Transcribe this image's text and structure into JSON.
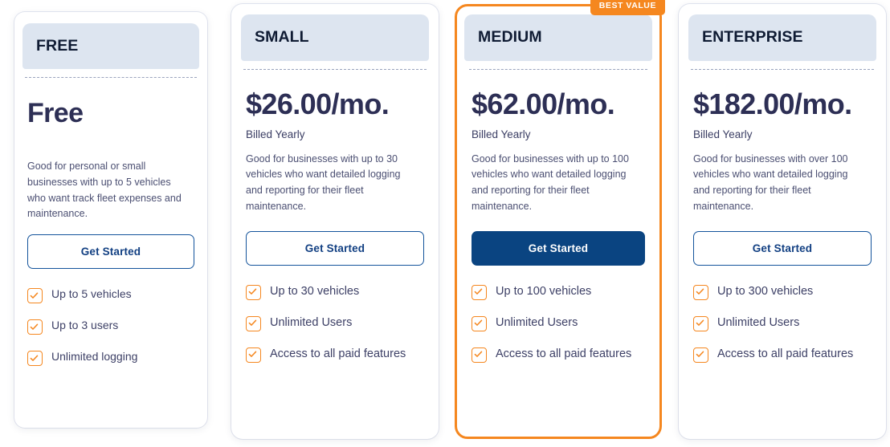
{
  "theme": {
    "accent_orange": "#f5871f",
    "primary_blue": "#0a4481",
    "outline_blue": "#13539b",
    "header_band": "#dde5f0",
    "heading_navy": "#0f1b33",
    "price_navy": "#2d2f55",
    "body_text": "#4b4f72"
  },
  "plans": [
    {
      "tier": "FREE",
      "price": "Free",
      "billing": "",
      "description": "Good for personal or small businesses with up to 5 vehicles who want track fleet expenses and maintenance.",
      "cta_label": "Get Started",
      "cta_style": "outline",
      "badge": "",
      "featured": false,
      "features": [
        "Up to 5 vehicles",
        "Up to 3 users",
        "Unlimited logging"
      ]
    },
    {
      "tier": "SMALL",
      "price": "$26.00/mo.",
      "billing": "Billed Yearly",
      "description": "Good for businesses with up to 30 vehicles who want detailed logging and reporting for their fleet maintenance.",
      "cta_label": "Get Started",
      "cta_style": "outline",
      "badge": "",
      "featured": false,
      "features": [
        "Up to 30 vehicles",
        "Unlimited Users",
        "Access to all paid features"
      ]
    },
    {
      "tier": "MEDIUM",
      "price": "$62.00/mo.",
      "billing": "Billed Yearly",
      "description": "Good for businesses with up to 100 vehicles who want detailed logging and reporting for their fleet maintenance.",
      "cta_label": "Get Started",
      "cta_style": "solid",
      "badge": "BEST VALUE",
      "featured": true,
      "features": [
        "Up to 100 vehicles",
        "Unlimited Users",
        "Access to all paid features"
      ]
    },
    {
      "tier": "ENTERPRISE",
      "price": "$182.00/mo.",
      "billing": "Billed Yearly",
      "description": "Good for businesses with over 100 vehicles who want detailed logging and reporting for their fleet maintenance.",
      "cta_label": "Get Started",
      "cta_style": "outline",
      "badge": "",
      "featured": false,
      "features": [
        "Up to 300 vehicles",
        "Unlimited Users",
        "Access to all paid features"
      ]
    }
  ]
}
